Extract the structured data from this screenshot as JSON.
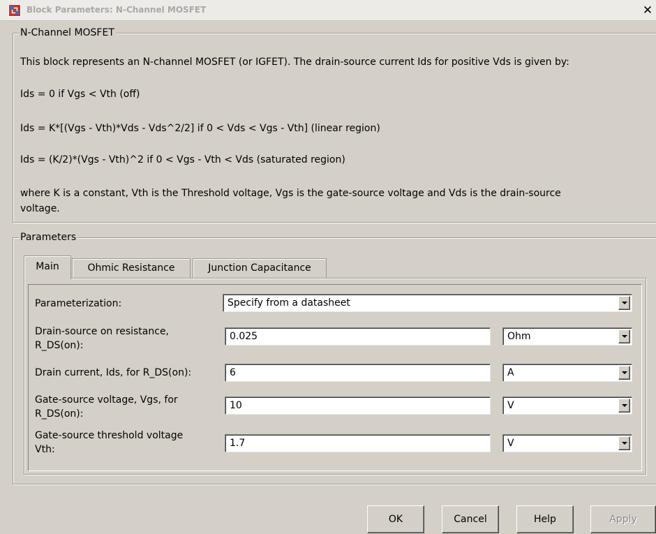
{
  "window": {
    "title": "Block Parameters: N-Channel MOSFET",
    "close_symbol": "✕"
  },
  "description": {
    "group_title": "N-Channel MOSFET",
    "lines": [
      "This block represents an N-channel MOSFET (or IGFET). The drain-source current Ids for positive Vds is given by:",
      "Ids = 0 if Vgs < Vth (off)",
      "Ids = K*[(Vgs - Vth)*Vds - Vds^2/2] if 0 < Vds < Vgs - Vth] (linear region)",
      "Ids = (K/2)*(Vgs - Vth)^2 if 0 < Vgs - Vth < Vds (saturated region)",
      "where K is a constant, Vth is the Threshold voltage, Vgs is the gate-source voltage and Vds is the drain-source",
      "voltage."
    ]
  },
  "parameters": {
    "group_title": "Parameters",
    "tabs": [
      {
        "label": "Main",
        "active": true
      },
      {
        "label": "Ohmic Resistance",
        "active": false
      },
      {
        "label": "Junction Capacitance",
        "active": false
      }
    ],
    "parameterization": {
      "label": "Parameterization:",
      "value": "Specify from a datasheet"
    },
    "rows": [
      {
        "label_line1": "Drain-source on resistance,",
        "label_line2": "R_DS(on):",
        "value": "0.025",
        "unit": "Ohm"
      },
      {
        "label_line1": "Drain current, Ids, for R_DS(on):",
        "label_line2": "",
        "value": "6",
        "unit": "A"
      },
      {
        "label_line1": "Gate-source voltage, Vgs, for",
        "label_line2": "R_DS(on):",
        "value": "10",
        "unit": "V"
      },
      {
        "label_line1": "Gate-source threshold voltage",
        "label_line2": "Vth:",
        "value": "1.7",
        "unit": "V"
      }
    ]
  },
  "buttons": {
    "ok": "OK",
    "cancel": "Cancel",
    "help": "Help",
    "apply": "Apply"
  },
  "icons": {
    "app": "simulink-block-icon",
    "dropdown": "dropdown-arrow-icon",
    "close": "close-icon"
  }
}
